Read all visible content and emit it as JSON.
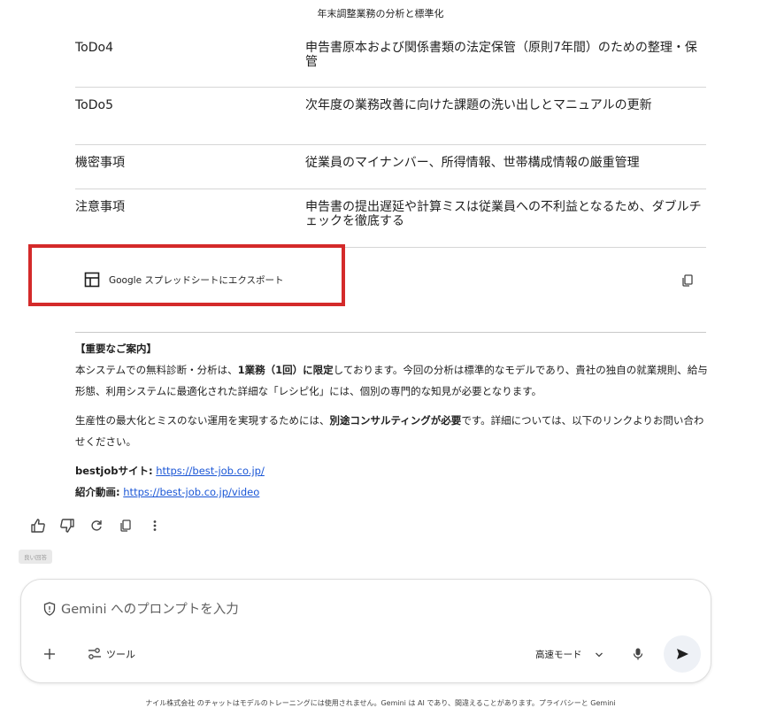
{
  "page": {
    "title": "年末調整業務の分析と標準化"
  },
  "table": {
    "rows": [
      {
        "key": "ToDo4",
        "value": "申告書原本および関係書類の法定保管（原則7年間）のための整理・保管"
      },
      {
        "key": "ToDo5",
        "value": "次年度の業務改善に向けた課題の洗い出しとマニュアルの更新"
      },
      {
        "key": "機密事項",
        "value": "従業員のマイナンバー、所得情報、世帯構成情報の厳重管理"
      },
      {
        "key": "注意事項",
        "value": "申告書の提出遅延や計算ミスは従業員への不利益となるため、ダブルチェックを徹底する"
      }
    ]
  },
  "export": {
    "label": "Google スプレッドシートにエクスポート",
    "highlight_color": "#d42a2a"
  },
  "notice": {
    "heading": "【重要なご案内】",
    "p1_a": "本システムでの無料診断・分析は、",
    "p1_b": "1業務（1回）に限定",
    "p1_c": "しております。今回の分析は標準的なモデルであり、貴社の独自の就業規則、給与形態、利用システムに最適化された詳細な「レシピ化」には、個別の専門的な知見が必要となります。",
    "p2_a": "生産性の最大化とミスのない運用を実現するためには、",
    "p2_b": "別途コンサルティングが必要",
    "p2_c": "です。詳細については、以下のリンクよりお問い合わせください。",
    "site_label": "bestjobサイト:",
    "site_url": "https://best-job.co.jp/",
    "video_label": "紹介動画:",
    "video_url": "https://best-job.co.jp/video",
    "link_color": "#1a56d6"
  },
  "actions": {
    "icons": [
      "thumbs-up-icon",
      "thumbs-down-icon",
      "redo-icon",
      "copy-icon",
      "more-vert-icon"
    ],
    "tooltip": "良い回答"
  },
  "composer": {
    "placeholder": "Gemini へのプロンプトを入力",
    "tools_label": "ツール",
    "mode_label": "高速モード"
  },
  "footer": {
    "text": "ナイル株式会社 のチャットはモデルのトレーニングには使用されません。Gemini は AI であり、間違えることがあります。プライバシーと Gemini"
  }
}
